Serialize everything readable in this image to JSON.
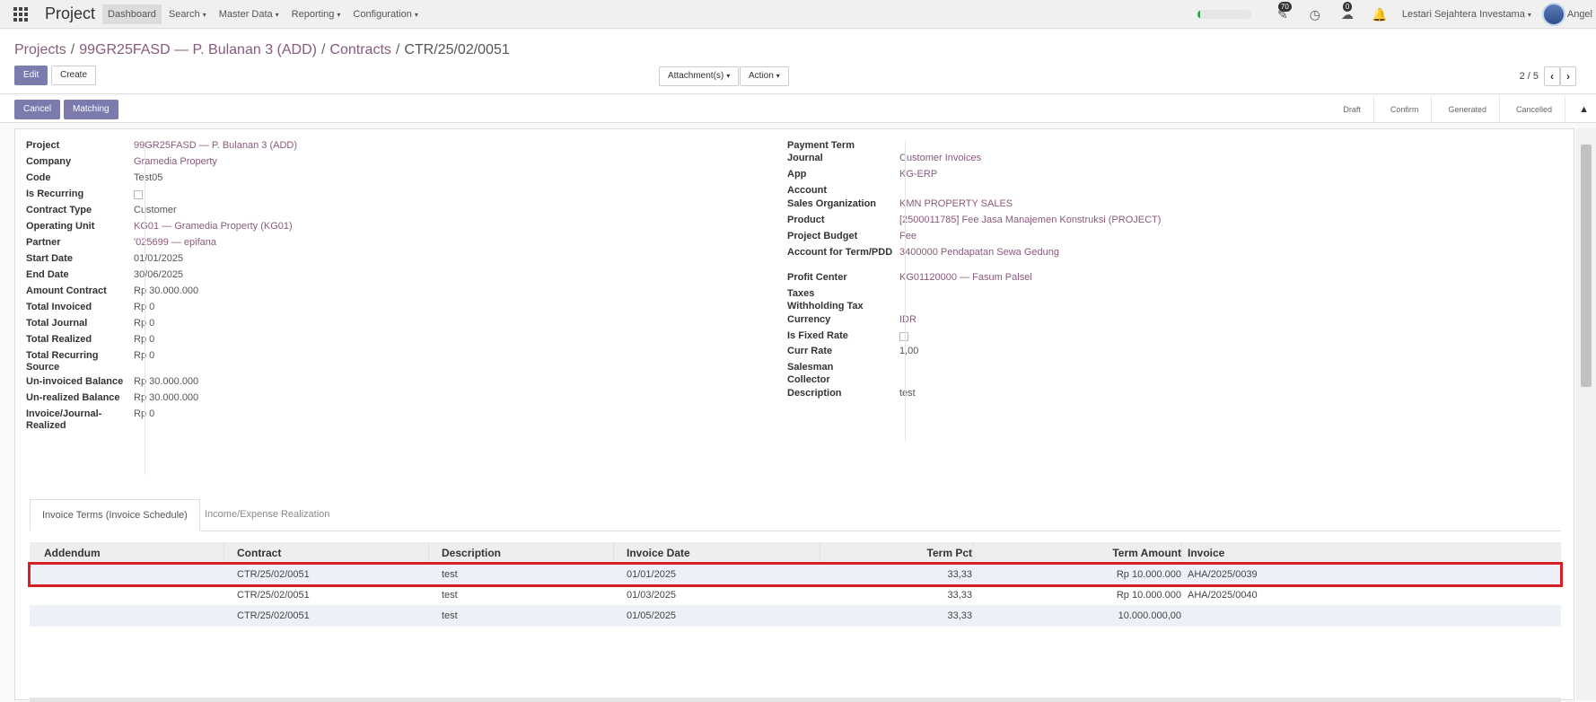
{
  "navbar": {
    "app_title": "Project",
    "menu": [
      {
        "label": "Dashboard",
        "caret": false
      },
      {
        "label": "Search",
        "caret": true
      },
      {
        "label": "Master Data",
        "caret": true
      },
      {
        "label": "Reporting",
        "caret": true
      },
      {
        "label": "Configuration",
        "caret": true
      }
    ],
    "progress_fraction": 0.05,
    "progress_color": "#28a745",
    "activity_badge": "70",
    "messages_badge": "0",
    "company": "Lestari Sejahtera Investama",
    "user_name": "Angel"
  },
  "breadcrumb": {
    "items": [
      "Projects",
      "99GR25FASD — P. Bulanan 3 (ADD)",
      "Contracts"
    ],
    "current": "CTR/25/02/0051"
  },
  "control": {
    "edit_label": "Edit",
    "create_label": "Create",
    "attachment_label": "Attachment(s)",
    "action_label": "Action",
    "pager_value": "2 / 5"
  },
  "statusbar": {
    "cancel_label": "Cancel",
    "matching_label": "Matching",
    "stages": [
      "Draft",
      "Confirm",
      "Generated",
      "Cancelled"
    ]
  },
  "form_left": [
    {
      "label": "Project",
      "value": "99GR25FASD — P. Bulanan 3 (ADD)",
      "link": true
    },
    {
      "label": "Company",
      "value": "Gramedia Property",
      "link": true
    },
    {
      "label": "Code",
      "value": "Test05",
      "link": false
    },
    {
      "label": "Is Recurring",
      "value": "",
      "checkbox": true
    },
    {
      "label": "Contract Type",
      "value": "Customer",
      "link": false
    },
    {
      "label": "Operating Unit",
      "value": "KG01 — Gramedia Property (KG01)",
      "link": true
    },
    {
      "label": "Partner",
      "value": "'025699 — epifana",
      "link": true
    },
    {
      "label": "Start Date",
      "value": "01/01/2025",
      "link": false
    },
    {
      "label": "End Date",
      "value": "30/06/2025",
      "link": false
    },
    {
      "label": "Amount Contract",
      "value": "Rp 30.000.000",
      "link": false
    },
    {
      "label": "Total Invoiced",
      "value": "Rp 0",
      "link": false
    },
    {
      "label": "Total Journal",
      "value": "Rp 0",
      "link": false
    },
    {
      "label": "Total Realized",
      "value": "Rp 0",
      "link": false
    },
    {
      "label": "Total Recurring Source",
      "value": "Rp 0",
      "link": false
    },
    {
      "label": "Un-invoiced Balance",
      "value": "Rp 30.000.000",
      "link": false
    },
    {
      "label": "Un-realized Balance",
      "value": "Rp 30.000.000",
      "link": false
    },
    {
      "label": "Invoice/Journal-Realized",
      "value": "Rp 0",
      "link": false
    }
  ],
  "form_right": [
    {
      "label": "Payment Term",
      "value": "",
      "link": false
    },
    {
      "label": "Journal",
      "value": "Customer Invoices",
      "link": true
    },
    {
      "label": "App",
      "value": "KG-ERP",
      "link": true
    },
    {
      "label": "Account",
      "value": "",
      "link": false
    },
    {
      "label": "Sales Organization",
      "value": "KMN PROPERTY SALES",
      "link": true
    },
    {
      "label": "Product",
      "value": "[2500011785] Fee Jasa Manajemen Konstruksi (PROJECT)",
      "link": true
    },
    {
      "label": "Project Budget",
      "value": "Fee",
      "link": true
    },
    {
      "label": "Account for Term/PDD",
      "value": "3400000 Pendapatan Sewa Gedung",
      "link": true
    },
    {
      "label": "Profit Center",
      "value": "KG01120000 — Fasum Palsel",
      "link": true
    },
    {
      "label": "Taxes",
      "value": "",
      "link": false
    },
    {
      "label": "Withholding Tax",
      "value": "",
      "link": false
    },
    {
      "label": "Currency",
      "value": "IDR",
      "link": true
    },
    {
      "label": "Is Fixed Rate",
      "value": "",
      "checkbox": true
    },
    {
      "label": "Curr Rate",
      "value": "1,00",
      "link": false
    },
    {
      "label": "Salesman",
      "value": "",
      "link": false
    },
    {
      "label": "Collector",
      "value": "",
      "link": false
    },
    {
      "label": "Description",
      "value": "test",
      "link": false
    }
  ],
  "tabs": [
    {
      "label": "Invoice Terms (Invoice Schedule)",
      "active": true
    },
    {
      "label": "Income/Expense Realization",
      "active": false
    }
  ],
  "table": {
    "columns": [
      "Addendum",
      "Contract",
      "Description",
      "Invoice Date",
      "Term Pct",
      "Term Amount",
      "Invoice"
    ],
    "rows": [
      {
        "addendum": "",
        "contract": "CTR/25/02/0051",
        "description": "test",
        "invoice_date": "01/01/2025",
        "term_pct": "33,33",
        "term_amount": "Rp 10.000.000",
        "invoice": "AHA/2025/0039",
        "selected": true
      },
      {
        "addendum": "",
        "contract": "CTR/25/02/0051",
        "description": "test",
        "invoice_date": "01/03/2025",
        "term_pct": "33,33",
        "term_amount": "Rp 10.000.000",
        "invoice": "AHA/2025/0040",
        "selected": false
      },
      {
        "addendum": "",
        "contract": "CTR/25/02/0051",
        "description": "test",
        "invoice_date": "01/05/2025",
        "term_pct": "33,33",
        "term_amount": "10.000.000,00",
        "invoice": "",
        "selected": false
      }
    ]
  },
  "colors": {
    "accent": "#875a7b",
    "primary_button": "#7c7bad",
    "highlight_border": "#d62027"
  }
}
